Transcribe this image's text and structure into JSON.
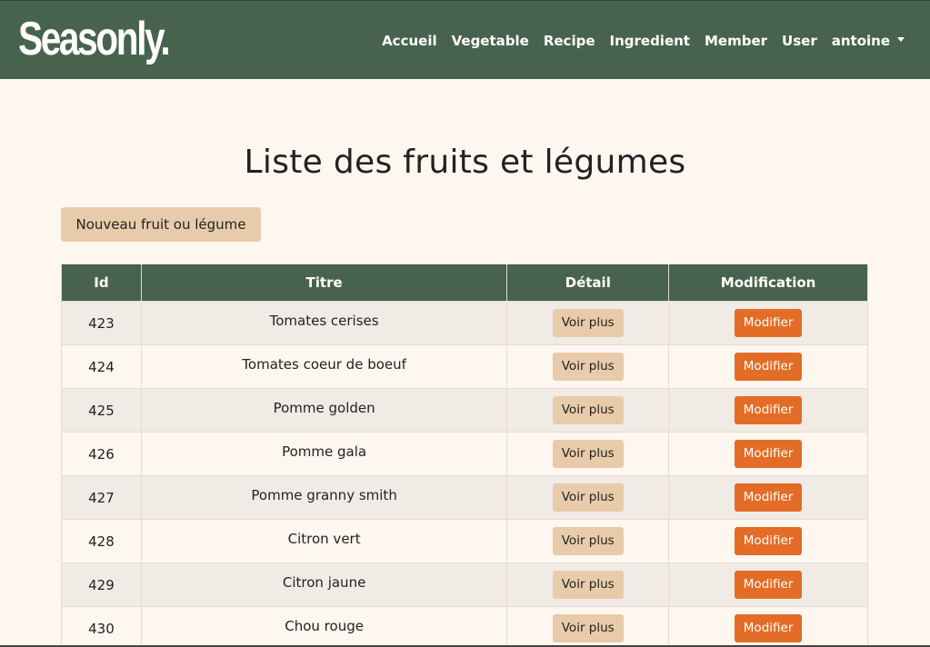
{
  "brand": {
    "logo_text": "Seasonly."
  },
  "nav": {
    "items": [
      {
        "label": "Accueil"
      },
      {
        "label": "Vegetable"
      },
      {
        "label": "Recipe"
      },
      {
        "label": "Ingredient"
      },
      {
        "label": "Member"
      },
      {
        "label": "User"
      }
    ],
    "user_menu_label": "antoine"
  },
  "main": {
    "title": "Liste des fruits et légumes",
    "new_button_label": "Nouveau fruit ou légume"
  },
  "table": {
    "headers": [
      "Id",
      "Titre",
      "Détail",
      "Modification"
    ],
    "detail_button_label": "Voir plus",
    "modify_button_label": "Modifier",
    "rows": [
      {
        "id": "423",
        "title": "Tomates cerises"
      },
      {
        "id": "424",
        "title": "Tomates coeur de boeuf"
      },
      {
        "id": "425",
        "title": "Pomme golden"
      },
      {
        "id": "426",
        "title": "Pomme gala"
      },
      {
        "id": "427",
        "title": "Pomme granny smith"
      },
      {
        "id": "428",
        "title": "Citron vert"
      },
      {
        "id": "429",
        "title": "Citron jaune"
      },
      {
        "id": "430",
        "title": "Chou rouge"
      }
    ]
  },
  "colors": {
    "nav_bg": "#47634d",
    "page_bg": "#fdf7f0",
    "detail_button_bg": "#e8cbaa",
    "modify_button_bg": "#e36c26"
  }
}
